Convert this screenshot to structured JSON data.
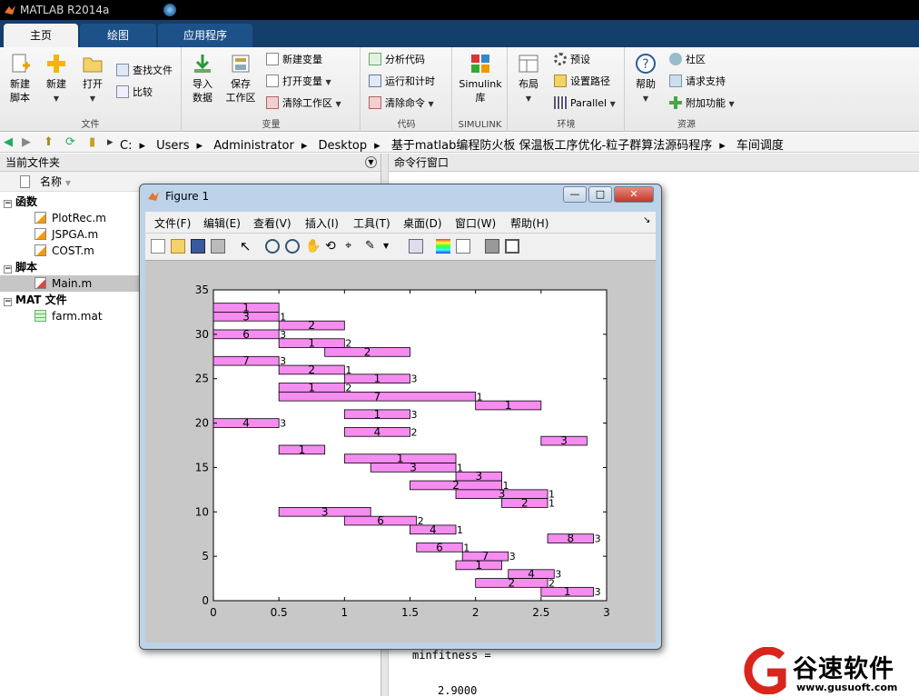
{
  "app": {
    "title": "MATLAB R2014a"
  },
  "tabs": [
    {
      "label": "主页"
    },
    {
      "label": "绘图"
    },
    {
      "label": "应用程序"
    }
  ],
  "ribbon": {
    "file": {
      "label": "文件",
      "new_script": "新建\n脚本",
      "new": "新建",
      "open": "打开",
      "find_files": "查找文件",
      "compare": "比较"
    },
    "variable": {
      "label": "变量",
      "import": "导入\n数据",
      "save_ws": "保存\n工作区",
      "new_var": "新建变量",
      "open_var": "打开变量",
      "clear_ws": "清除工作区"
    },
    "code": {
      "label": "代码",
      "analyze": "分析代码",
      "run_time": "运行和计时",
      "clear_cmd": "清除命令"
    },
    "simulink": {
      "label": "SIMULINK",
      "lib": "Simulink\n库"
    },
    "env": {
      "label": "环境",
      "layout": "布局",
      "prefs": "预设",
      "set_path": "设置路径",
      "parallel": "Parallel"
    },
    "resources": {
      "label": "资源",
      "help": "帮助",
      "community": "社区",
      "support": "请求支持",
      "addons": "附加功能"
    }
  },
  "address": {
    "crumbs": [
      "C:",
      "Users",
      "Administrator",
      "Desktop",
      "基于matlab编程防火板 保温板工序优化-粒子群算法源码程序",
      "车间调度"
    ]
  },
  "current_folder": {
    "title": "当前文件夹",
    "name_col": "名称",
    "groups": [
      {
        "label": "函数",
        "files": [
          "PlotRec.m",
          "JSPGA.m",
          "COST.m"
        ]
      },
      {
        "label": "脚本",
        "files": [
          "Main.m"
        ]
      },
      {
        "label": "MAT 文件",
        "files": [
          "farm.mat"
        ]
      }
    ]
  },
  "command_window": {
    "title": "命令行窗口",
    "line1": "minfitness =",
    "line2": "2.9000"
  },
  "figure": {
    "title": "Figure 1",
    "menu": [
      "文件(F)",
      "编辑(E)",
      "查看(V)",
      "插入(I)",
      "工具(T)",
      "桌面(D)",
      "窗口(W)",
      "帮助(H)"
    ],
    "min": "—",
    "max": "□",
    "close": "✕"
  },
  "watermark": {
    "brand": "谷速软件",
    "url": "www.gusuoft.com"
  },
  "chart_data": {
    "type": "gantt",
    "xlim": [
      0,
      3
    ],
    "ylim": [
      0,
      35
    ],
    "xticks": [
      0,
      0.5,
      1,
      1.5,
      2,
      2.5,
      3
    ],
    "yticks": [
      0,
      5,
      10,
      15,
      20,
      25,
      30,
      35
    ],
    "bar_color": "#f58cf0",
    "bars": [
      {
        "y": 33,
        "x1": 0,
        "x2": 0.5,
        "label": "1",
        "end": ""
      },
      {
        "y": 32,
        "x1": 0,
        "x2": 0.5,
        "label": "3",
        "end": "1"
      },
      {
        "y": 31,
        "x1": 0.5,
        "x2": 1,
        "label": "2",
        "end": ""
      },
      {
        "y": 30,
        "x1": 0,
        "x2": 0.5,
        "label": "6",
        "end": "3"
      },
      {
        "y": 29,
        "x1": 0.5,
        "x2": 1,
        "label": "1",
        "end": "2"
      },
      {
        "y": 28,
        "x1": 0.85,
        "x2": 1.5,
        "label": "2",
        "end": ""
      },
      {
        "y": 27,
        "x1": 0,
        "x2": 0.5,
        "label": "7",
        "end": "3"
      },
      {
        "y": 26,
        "x1": 0.5,
        "x2": 1,
        "label": "2",
        "end": "1"
      },
      {
        "y": 25,
        "x1": 1,
        "x2": 1.5,
        "label": "1",
        "end": "3"
      },
      {
        "y": 24,
        "x1": 0.5,
        "x2": 1,
        "label": "1",
        "end": "2"
      },
      {
        "y": 23,
        "x1": 0.5,
        "x2": 2,
        "label": "7",
        "end": "1"
      },
      {
        "y": 22,
        "x1": 2,
        "x2": 2.5,
        "label": "1",
        "end": ""
      },
      {
        "y": 21,
        "x1": 1,
        "x2": 1.5,
        "label": "1",
        "end": "3"
      },
      {
        "y": 20,
        "x1": 0,
        "x2": 0.5,
        "label": "4",
        "end": "3"
      },
      {
        "y": 19,
        "x1": 1,
        "x2": 1.5,
        "label": "4",
        "end": "2"
      },
      {
        "y": 18,
        "x1": 2.5,
        "x2": 2.85,
        "label": "3",
        "end": ""
      },
      {
        "y": 17,
        "x1": 0.5,
        "x2": 0.85,
        "label": "1",
        "end": ""
      },
      {
        "y": 16,
        "x1": 1,
        "x2": 1.85,
        "label": "1",
        "end": ""
      },
      {
        "y": 15,
        "x1": 1.2,
        "x2": 1.85,
        "label": "3",
        "end": "1"
      },
      {
        "y": 14,
        "x1": 1.85,
        "x2": 2.2,
        "label": "3",
        "end": ""
      },
      {
        "y": 13,
        "x1": 1.5,
        "x2": 2.2,
        "label": "2",
        "end": "1"
      },
      {
        "y": 12,
        "x1": 1.85,
        "x2": 2.55,
        "label": "3",
        "end": "1"
      },
      {
        "y": 11,
        "x1": 2.2,
        "x2": 2.55,
        "label": "2",
        "end": "1"
      },
      {
        "y": 10,
        "x1": 0.5,
        "x2": 1.2,
        "label": "3",
        "end": ""
      },
      {
        "y": 9,
        "x1": 1,
        "x2": 1.55,
        "label": "6",
        "end": "2"
      },
      {
        "y": 8,
        "x1": 1.5,
        "x2": 1.85,
        "label": "4",
        "end": "1"
      },
      {
        "y": 7,
        "x1": 2.55,
        "x2": 2.9,
        "label": "8",
        "end": "3"
      },
      {
        "y": 6,
        "x1": 1.55,
        "x2": 1.9,
        "label": "6",
        "end": "1"
      },
      {
        "y": 5,
        "x1": 1.9,
        "x2": 2.25,
        "label": "7",
        "end": "3"
      },
      {
        "y": 4,
        "x1": 1.85,
        "x2": 2.2,
        "label": "1",
        "end": ""
      },
      {
        "y": 3,
        "x1": 2.25,
        "x2": 2.6,
        "label": "4",
        "end": "3"
      },
      {
        "y": 2,
        "x1": 2,
        "x2": 2.55,
        "label": "2",
        "end": "2"
      },
      {
        "y": 1,
        "x1": 2.5,
        "x2": 2.9,
        "label": "1",
        "end": "3"
      }
    ]
  }
}
